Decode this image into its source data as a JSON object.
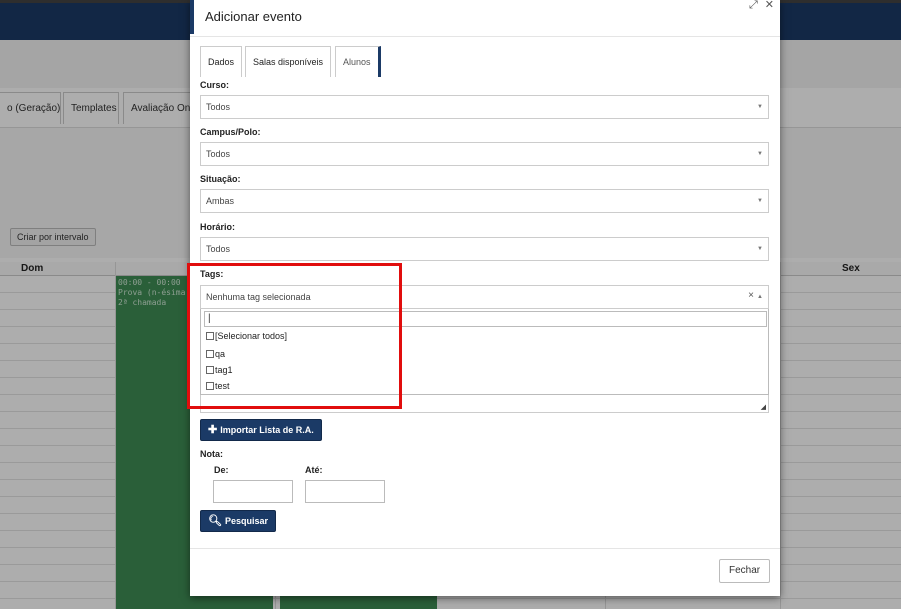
{
  "background": {
    "tabs": [
      {
        "label": "o (Geração)"
      },
      {
        "label": "Templates"
      },
      {
        "label": "Avaliação Online"
      }
    ],
    "criar_button": "Criar por intervalo",
    "calendar": {
      "days": {
        "dom": "Dom",
        "sex": "Sex"
      },
      "event": {
        "time": "00:00 - 00:00",
        "line1": "Prova (n-ésima ch",
        "line2": "2ª chamada"
      }
    }
  },
  "modal": {
    "title": "Adicionar evento",
    "icons": {
      "expand": "expand-icon",
      "close": "close-icon"
    },
    "tabs": [
      {
        "label": "Dados"
      },
      {
        "label": "Salas disponíveis"
      },
      {
        "label": "Alunos"
      }
    ],
    "fields": {
      "curso": {
        "label": "Curso:",
        "value": "Todos"
      },
      "campus": {
        "label": "Campus/Polo:",
        "value": "Todos"
      },
      "situacao": {
        "label": "Situação:",
        "value": "Ambas"
      },
      "horario": {
        "label": "Horário:",
        "value": "Todos"
      },
      "tags": {
        "label": "Tags:",
        "value": "Nenhuma tag selecionada",
        "clear": "×"
      }
    },
    "tags_dropdown": {
      "search_value": "|",
      "options": [
        {
          "label": "[Selecionar todos]"
        },
        {
          "label": "qa"
        },
        {
          "label": "tag1"
        },
        {
          "label": "test"
        }
      ]
    },
    "import_button": "Importar Lista de R.A.",
    "nota": {
      "label": "Nota:",
      "de": "De:",
      "ate": "Até:"
    },
    "search_button": "Pesquisar",
    "close_button": "Fechar"
  },
  "colors": {
    "primary": "#1b3a66",
    "highlight": "#e10d0d",
    "event": "#3e8c55"
  }
}
